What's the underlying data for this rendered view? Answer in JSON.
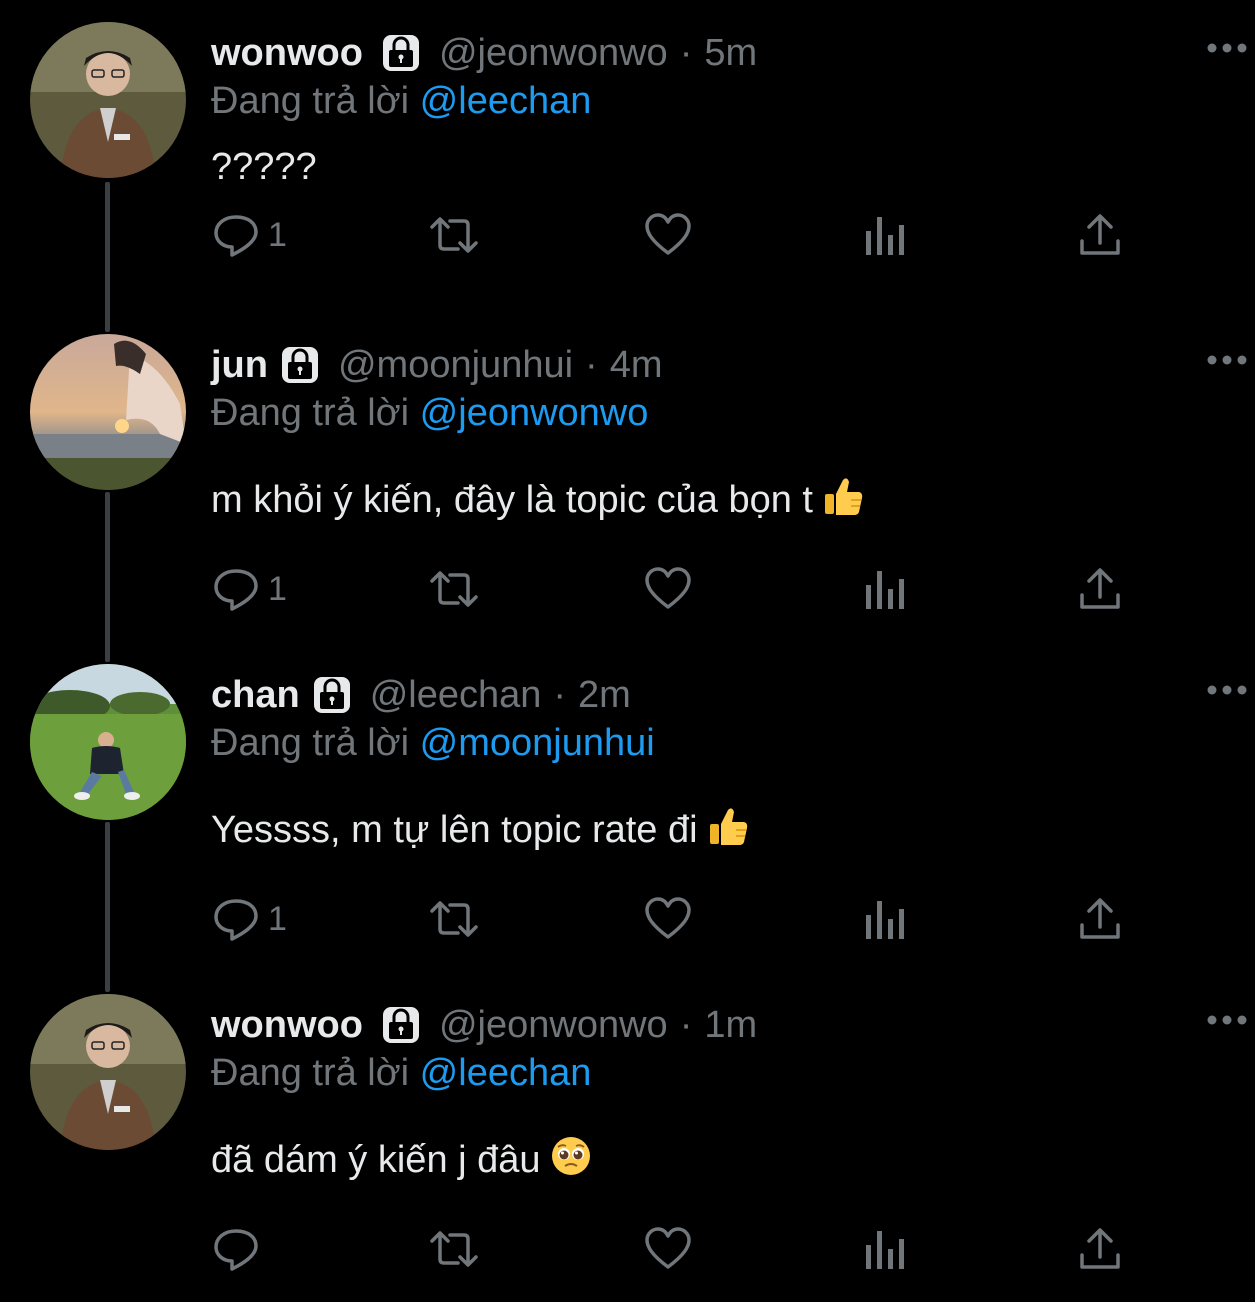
{
  "colors": {
    "background": "#000000",
    "text": "#e7e9ea",
    "muted": "#71767b",
    "link": "#1d9bf0",
    "thread_line": "#3a3f45"
  },
  "tweets": [
    {
      "name": "wonwoo",
      "handle": "@jeonwonwo",
      "separator": "·",
      "time": "5m",
      "replying_label": "Đang trả lời",
      "reply_to": "@leechan",
      "text": "?????",
      "emoji": "",
      "reply_count": "1",
      "avatar": "wonwoo-avatar"
    },
    {
      "name": "jun",
      "handle": "@moonjunhui",
      "separator": "·",
      "time": "4m",
      "replying_label": "Đang trả lời",
      "reply_to": "@jeonwonwo",
      "text": "m khỏi ý kiến, đây là topic của bọn t",
      "emoji": "thumbs-up-emoji",
      "reply_count": "1",
      "avatar": "sunset-hands-avatar"
    },
    {
      "name": "chan",
      "handle": "@leechan",
      "separator": "·",
      "time": "2m",
      "replying_label": "Đang trả lời",
      "reply_to": "@moonjunhui",
      "text": "Yessss, m tự lên topic rate đi",
      "emoji": "thumbs-up-emoji",
      "reply_count": "1",
      "avatar": "grass-park-avatar"
    },
    {
      "name": "wonwoo",
      "handle": "@jeonwonwo",
      "separator": "·",
      "time": "1m",
      "replying_label": "Đang trả lời",
      "reply_to": "@leechan",
      "text": "đã dám ý kiến j đâu",
      "emoji": "pleading-face-emoji",
      "reply_count": "",
      "avatar": "wonwoo-avatar"
    }
  ]
}
